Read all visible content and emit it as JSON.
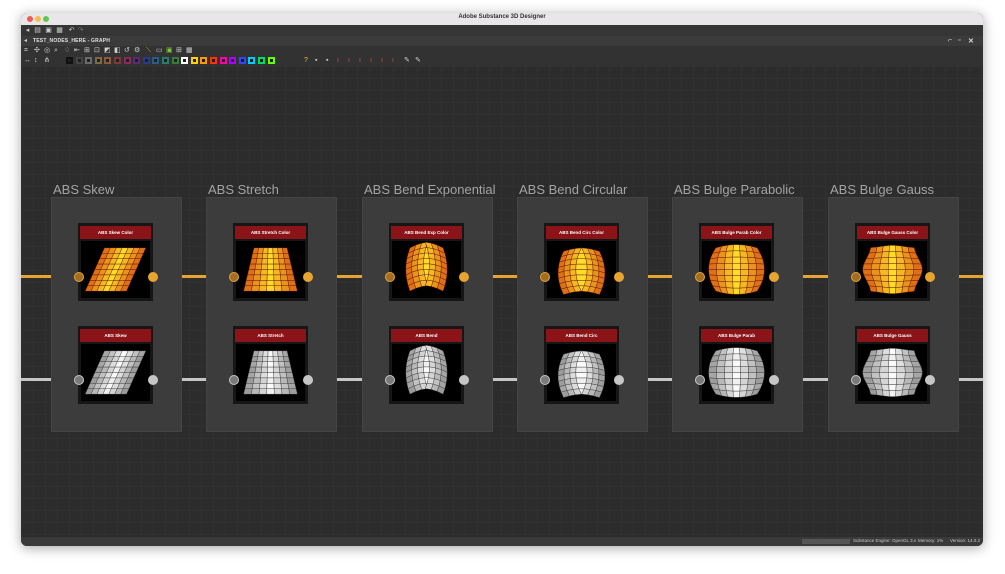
{
  "window": {
    "title": "Adobe Substance 3D Designer"
  },
  "graph": {
    "tab_title": "TEST_NODES_HERE - GRAPH"
  },
  "colors": {
    "accent_orange": "#e7a431",
    "wire_gray": "#c6c6c6",
    "node_label_red": "#8a1418"
  },
  "frames": [
    {
      "title": "ABS Skew",
      "color_node": "ABS Skew Color",
      "gray_node": "ABS Skew",
      "warp": "skew"
    },
    {
      "title": "ABS Stretch",
      "color_node": "ABS Stretch Color",
      "gray_node": "ABS Stretch",
      "warp": "stretch"
    },
    {
      "title": "ABS Bend Exponential",
      "color_node": "ABS Bend Exp Color",
      "gray_node": "ABS Bend",
      "warp": "bend"
    },
    {
      "title": "ABS Bend Circular",
      "color_node": "ABS Bend Circ Color",
      "gray_node": "ABS Bend Circ",
      "warp": "circ"
    },
    {
      "title": "ABS Bulge Parabolic",
      "color_node": "ABS Bulge Parab Color",
      "gray_node": "ABS Bulge Parab",
      "warp": "parab"
    },
    {
      "title": "ABS Bulge Gauss",
      "color_node": "ABS Bulge Gauss Color",
      "gray_node": "ABS Bulge Gauss",
      "warp": "gauss"
    }
  ],
  "status": {
    "engine": "Substance Engine: OpenGL 3.x",
    "memory": "Memory: 1%",
    "version": "Version: 14.0.2"
  }
}
